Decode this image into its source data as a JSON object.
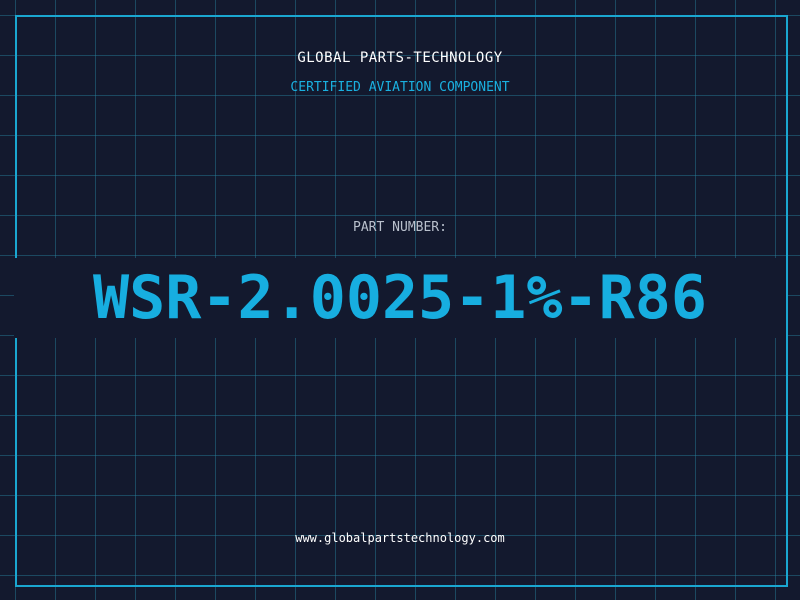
{
  "header": {
    "company": "GLOBAL PARTS-TECHNOLOGY",
    "subtitle": "CERTIFIED AVIATION COMPONENT"
  },
  "part": {
    "label": "PART NUMBER:",
    "number": "WSR-2.0025-1%-R86"
  },
  "footer": {
    "website": "www.globalpartstechnology.com"
  },
  "colors": {
    "background": "#13192e",
    "grid": "#28829f",
    "accent": "#1aa6d0",
    "text": "#ffffff"
  }
}
